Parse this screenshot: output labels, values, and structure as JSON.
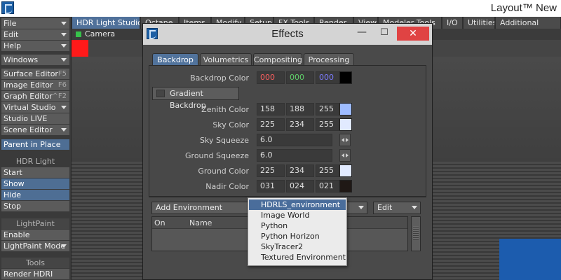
{
  "window": {
    "title": "Layout™ New"
  },
  "left_toolbar": {
    "file": "File",
    "edit": "Edit",
    "help": "Help",
    "windows": "Windows",
    "surface_editor": "Surface Editor",
    "surface_editor_key": "F5",
    "image_editor": "Image Editor",
    "image_editor_key": "F6",
    "graph_editor": "Graph Editor",
    "graph_editor_key": "^F2",
    "virtual_studio": "Virtual Studio",
    "studio_live": "Studio LIVE",
    "scene_editor": "Scene Editor",
    "parent_in_place": "Parent in Place",
    "hdr_header": "HDR Light Studio...",
    "start": "Start",
    "show": "Show",
    "hide": "Hide",
    "stop": "Stop",
    "lightpaint_header": "LightPaint",
    "enable": "Enable",
    "lightpaint_mode": "LightPaint Mode",
    "tools_header": "Tools",
    "render_hdri": "Render HDRI"
  },
  "tabs": [
    "HDR Light Studio",
    "Octane",
    "Items",
    "Modify",
    "Setup",
    "FX Tools",
    "Render",
    "View",
    "Modeler Tools",
    "I/O",
    "Utilities",
    "Additional"
  ],
  "viewport": {
    "camera_label": "Camera"
  },
  "dialog": {
    "title": "Effects",
    "tabs": [
      "Backdrop",
      "Volumetrics",
      "Compositing",
      "Processing"
    ],
    "backdrop_color": {
      "label": "Backdrop Color",
      "r": "000",
      "g": "000",
      "b": "000",
      "swatch": "#000000"
    },
    "gradient_backdrop": "Gradient Backdrop",
    "zenith_color": {
      "label": "Zenith Color",
      "r": "158",
      "g": "188",
      "b": "255",
      "swatch": "#9ebcff"
    },
    "sky_color": {
      "label": "Sky Color",
      "r": "225",
      "g": "234",
      "b": "255",
      "swatch": "#e1eaff"
    },
    "sky_squeeze": {
      "label": "Sky Squeeze",
      "value": "6.0"
    },
    "ground_squeeze": {
      "label": "Ground Squeeze",
      "value": "6.0"
    },
    "ground_color": {
      "label": "Ground Color",
      "r": "225",
      "g": "234",
      "b": "255",
      "swatch": "#e1eaff"
    },
    "nadir_color": {
      "label": "Nadir Color",
      "r": "031",
      "g": "024",
      "b": "021",
      "swatch": "#1f1815"
    },
    "add_environment": "Add Environment",
    "edit": "Edit",
    "columns": {
      "on": "On",
      "name": "Name"
    }
  },
  "dropdown": {
    "items": [
      "HDRLS_environment",
      "Image World",
      "Python",
      "Python Horizon",
      "SkyTracer2",
      "Textured Environment"
    ],
    "selected": "HDRLS_environment"
  }
}
